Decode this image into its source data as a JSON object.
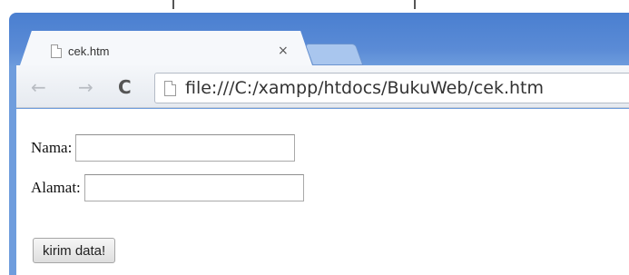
{
  "tab": {
    "title": "cek.htm",
    "close_glyph": "×",
    "icon": "page-icon"
  },
  "toolbar": {
    "back_glyph": "←",
    "forward_glyph": "→",
    "reload_glyph": "C",
    "address": "file:///C:/xampp/htdocs/BukuWeb/cek.htm",
    "address_icon": "page-icon"
  },
  "form": {
    "nama_label": "Nama:",
    "nama_value": "",
    "alamat_label": "Alamat:",
    "alamat_value": "",
    "submit_label": "kirim data!"
  },
  "colors": {
    "window_frame": "#5a8bd6",
    "new_tab": "#a9c6ee"
  }
}
